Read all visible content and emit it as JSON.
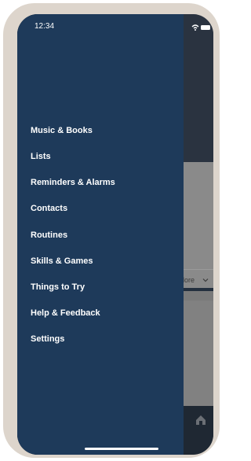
{
  "status_bar": {
    "time": "12:34"
  },
  "menu": {
    "items": [
      {
        "label": "Music & Books"
      },
      {
        "label": "Lists"
      },
      {
        "label": "Reminders & Alarms"
      },
      {
        "label": "Contacts"
      },
      {
        "label": "Routines"
      },
      {
        "label": "Skills & Games"
      },
      {
        "label": "Things to Try"
      },
      {
        "label": "Help & Feedback"
      },
      {
        "label": "Settings"
      }
    ]
  },
  "background": {
    "more_label": "lore"
  },
  "colors": {
    "drawer": "#1e3a5a",
    "frame": "#ddd5cc",
    "text": "#ffffff"
  },
  "icons": {
    "wifi": "wifi-icon",
    "battery": "battery-icon",
    "chevron": "chevron-down-icon",
    "home": "home-icon"
  }
}
